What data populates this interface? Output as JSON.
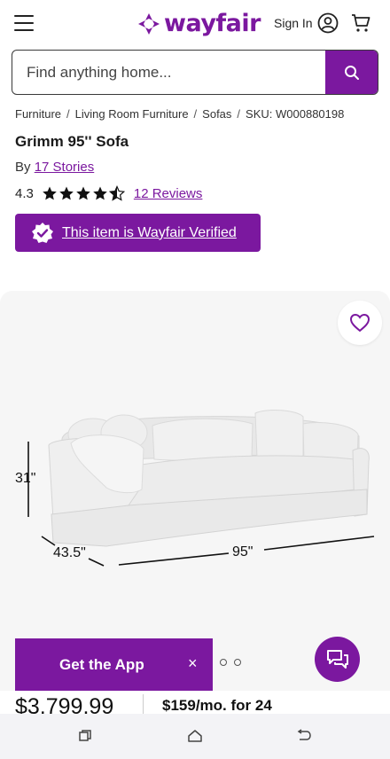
{
  "header": {
    "logo_text": "wayfair",
    "sign_in_label": "Sign In",
    "brand_color": "#7b189f",
    "icons": [
      "menu-icon",
      "wayfair-logo-icon",
      "user-icon",
      "cart-icon"
    ]
  },
  "search": {
    "placeholder": "Find anything home...",
    "value": ""
  },
  "breadcrumb": {
    "items": [
      "Furniture",
      "Living Room Furniture",
      "Sofas"
    ],
    "separator": "/",
    "sku": "SKU: W000880198"
  },
  "product": {
    "title": "Grimm 95'' Sofa",
    "by_prefix": "By",
    "brand": "17 Stories",
    "rating_value": "4.3",
    "rating_stars": 4.3,
    "reviews_label": "12 Reviews",
    "verified_label": "This item is Wayfair Verified"
  },
  "gallery": {
    "dimensions": {
      "height": "31\"",
      "depth": "43.5\"",
      "width": "95\""
    },
    "slide_count": 3
  },
  "app_banner": {
    "label": "Get the App",
    "close_symbol": "×"
  },
  "pricing": {
    "price": "$3,799.99",
    "monthly": "$159/mo. for 24"
  },
  "system_nav": {
    "icons": [
      "recent-apps-icon",
      "home-icon",
      "back-icon"
    ]
  }
}
